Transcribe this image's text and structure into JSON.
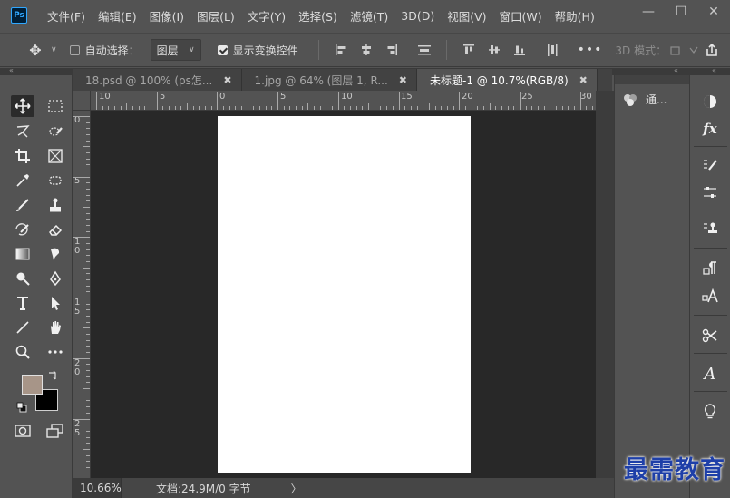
{
  "app": {
    "logo": "Ps"
  },
  "menu": [
    {
      "label": "文件(F)"
    },
    {
      "label": "编辑(E)"
    },
    {
      "label": "图像(I)"
    },
    {
      "label": "图层(L)"
    },
    {
      "label": "文字(Y)"
    },
    {
      "label": "选择(S)"
    },
    {
      "label": "滤镜(T)"
    },
    {
      "label": "3D(D)"
    },
    {
      "label": "视图(V)"
    },
    {
      "label": "窗口(W)"
    },
    {
      "label": "帮助(H)"
    }
  ],
  "window_controls": {
    "minimize": "—",
    "restore": "☐",
    "close": "✕"
  },
  "options": {
    "auto_select_label": "自动选择：",
    "layer_select_value": "图层",
    "show_transform_label": "显示变换控件",
    "more": "•••",
    "mode_3d": "3D 模式："
  },
  "tabs": [
    {
      "label": "18.psd @ 100% (ps怎...",
      "active": false
    },
    {
      "label": "1.jpg @ 64% (图层 1, R...",
      "active": false
    },
    {
      "label": "未标题-1 @ 10.7%(RGB/8)",
      "active": true
    }
  ],
  "ruler": {
    "h_labels": [
      "10",
      "5",
      "0",
      "5",
      "10",
      "15",
      "20",
      "25",
      "30"
    ],
    "v_labels": [
      "0",
      "5",
      "1 0",
      "1 5",
      "2 0",
      "2 5"
    ]
  },
  "status": {
    "zoom": "10.66%",
    "doc_info": "文档:24.9M/0 字节",
    "arrow": "〉"
  },
  "panels": {
    "channels_label": "通..."
  },
  "colors": {
    "foreground": "#a79588",
    "background": "#000000",
    "accent": "#31a8ff"
  },
  "watermark": "最需教育"
}
